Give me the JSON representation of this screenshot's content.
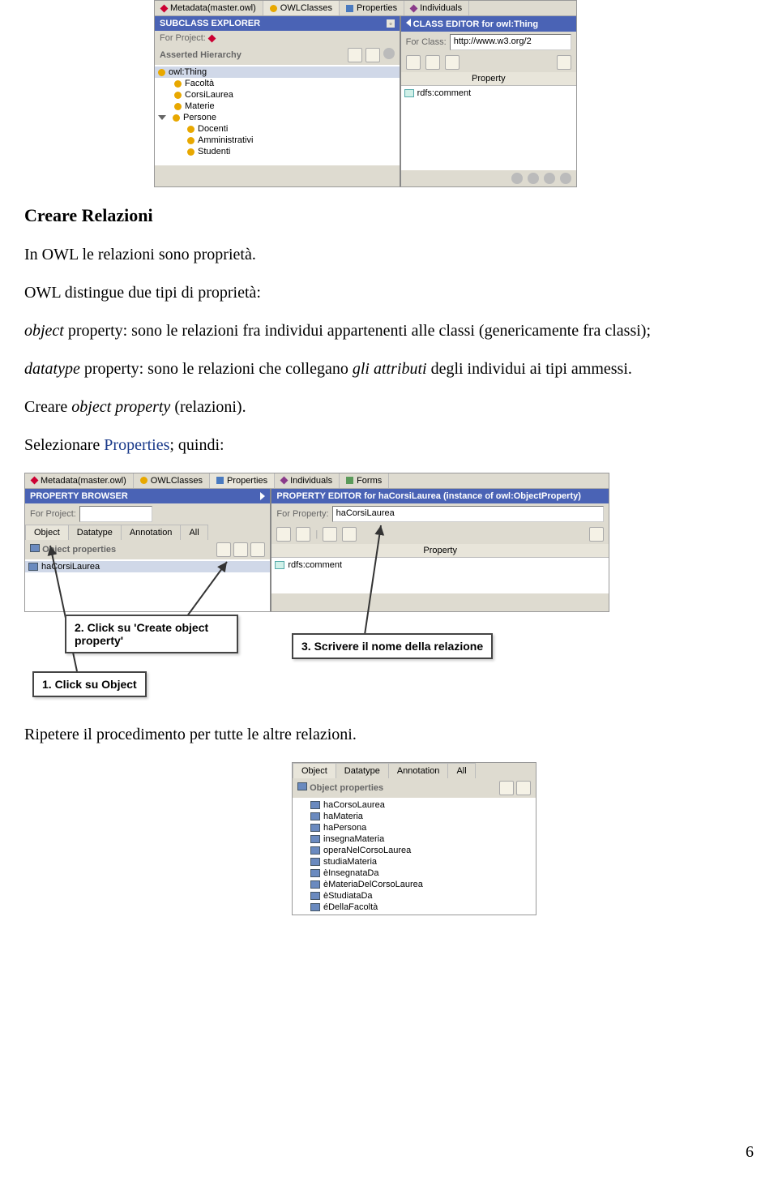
{
  "tabs1": {
    "metadata": "Metadata(master.owl)",
    "owlclasses": "OWLClasses",
    "properties": "Properties",
    "individuals": "Individuals"
  },
  "sc_explorer": {
    "title": "SUBCLASS EXPLORER",
    "for_project": "For Project:",
    "asserted": "Asserted Hierarchy",
    "tree": [
      "owl:Thing",
      "Facoltà",
      "CorsiLaurea",
      "Materie",
      "Persone",
      "Docenti",
      "Amministrativi",
      "Studenti"
    ]
  },
  "cl_editor": {
    "title": "CLASS EDITOR for owl:Thing",
    "for_class": "For Class:",
    "class_val": "http://www.w3.org/2",
    "prop_col": "Property",
    "rdfs": "rdfs:comment"
  },
  "body": {
    "h2": "Creare Relazioni",
    "p1a": "In OWL le relazioni sono proprietà.",
    "p2a": "OWL distingue due tipi di proprietà:",
    "p3a": "object",
    "p3b": " property: sono le relazioni fra individui appartenenti alle classi (genericamente fra classi);",
    "p4a": "datatype",
    "p4b": " property: sono le relazioni che collegano ",
    "p4c": "gli attributi",
    "p4d": " degli individui ai tipi ammessi.",
    "p5a": "Creare ",
    "p5b": "object property",
    "p5c": " (relazioni).",
    "p6a": "Selezionare ",
    "p6b": "Properties",
    "p6c": "; quindi:",
    "p7": "Ripetere il procedimento per tutte le altre relazioni."
  },
  "tabs2": {
    "metadata": "Metadata(master.owl)",
    "owlclasses": "OWLClasses",
    "properties": "Properties",
    "individuals": "Individuals",
    "forms": "Forms"
  },
  "pbrowser": {
    "title": "PROPERTY BROWSER",
    "for_project": "For Project:",
    "subtabs": [
      "Object",
      "Datatype",
      "Annotation",
      "All"
    ],
    "objprops": "Object properties",
    "item": "haCorsiLaurea"
  },
  "peditor": {
    "title": "PROPERTY EDITOR for haCorsiLaurea   (instance of owl:ObjectProperty)",
    "for_prop": "For Property:",
    "prop_val": "haCorsiLaurea",
    "prop_col": "Property",
    "rdfs": "rdfs:comment"
  },
  "callouts": {
    "c1": "1. Click su Object",
    "c2": "2. Click su 'Create object property'",
    "c3": "3. Scrivere il nome della relazione"
  },
  "panel3": {
    "subtabs": [
      "Object",
      "Datatype",
      "Annotation",
      "All"
    ],
    "objprops": "Object properties",
    "items": [
      "haCorsoLaurea",
      "haMateria",
      "haPersona",
      "insegnaMateria",
      "operaNelCorsoLaurea",
      "studiaMateria",
      "èInsegnataDa",
      "èMateriaDelCorsoLaurea",
      "èStudiataDa",
      "éDellaFacoltà"
    ]
  },
  "pagenum": "6"
}
